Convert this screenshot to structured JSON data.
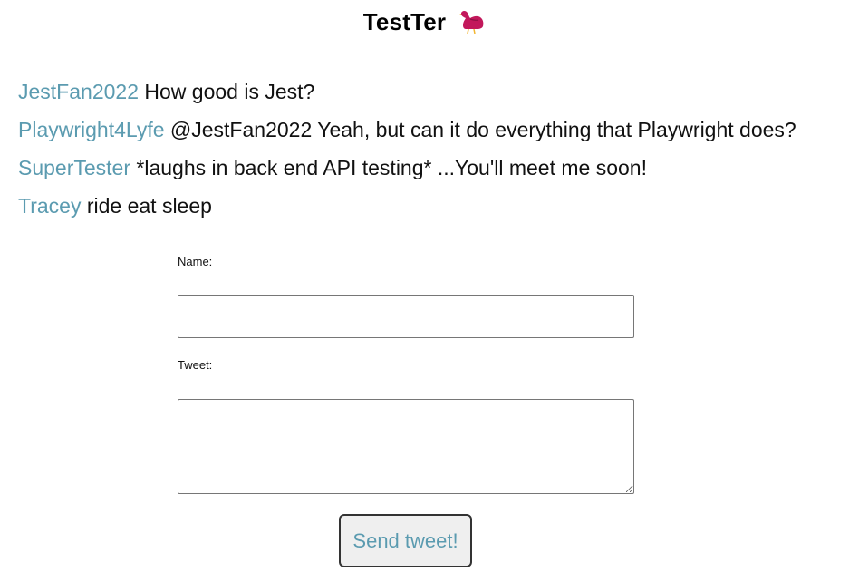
{
  "app": {
    "title": "TestTer",
    "logo_icon": "bird-icon",
    "brand_color": "#c2185b",
    "link_color": "#5b9bb0"
  },
  "tweets": [
    {
      "author": "JestFan2022",
      "text": "How good is Jest?"
    },
    {
      "author": "Playwright4Lyfe",
      "text": "@JestFan2022 Yeah, but can it do everything that Playwright does?"
    },
    {
      "author": "SuperTester",
      "text": "*laughs in back end API testing* ...You'll meet me soon!"
    },
    {
      "author": "Tracey",
      "text": "ride eat sleep"
    }
  ],
  "form": {
    "name_label": "Name:",
    "name_value": "",
    "tweet_label": "Tweet:",
    "tweet_value": "",
    "send_label": "Send tweet!"
  }
}
